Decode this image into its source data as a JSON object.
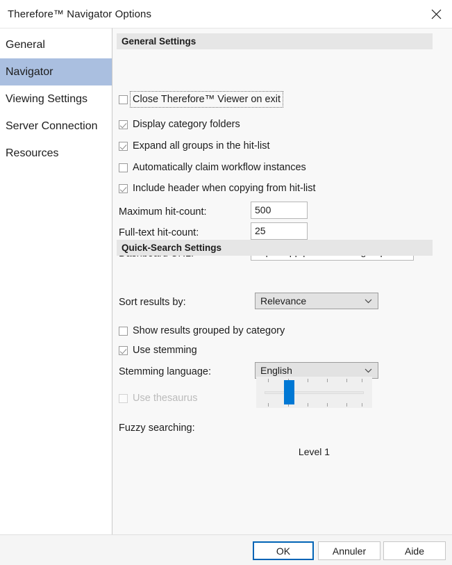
{
  "window": {
    "title": "Therefore™ Navigator Options",
    "close_icon": "close-icon"
  },
  "sidebar": {
    "items": [
      {
        "label": "General",
        "selected": false
      },
      {
        "label": "Navigator",
        "selected": true
      },
      {
        "label": "Viewing Settings",
        "selected": false
      },
      {
        "label": "Server Connection",
        "selected": false
      },
      {
        "label": "Resources",
        "selected": false
      }
    ],
    "selected_color": "#aabfe0"
  },
  "general_settings": {
    "header": "General Settings",
    "checkboxes": [
      {
        "label": "Close Therefore™ Viewer on exit",
        "checked": false,
        "enabled": true,
        "focused": true
      },
      {
        "label": "Display category folders",
        "checked": true,
        "enabled": true,
        "focused": false
      },
      {
        "label": "Expand all groups in the hit-list",
        "checked": true,
        "enabled": true,
        "focused": false
      },
      {
        "label": "Automatically claim workflow instances",
        "checked": false,
        "enabled": true,
        "focused": false
      },
      {
        "label": "Include header when copying from hit-list",
        "checked": true,
        "enabled": true,
        "focused": false
      }
    ],
    "fields": [
      {
        "label": "Maximum hit-count:",
        "value": "500"
      },
      {
        "label": "Full-text hit-count:",
        "value": "25"
      },
      {
        "label": "Dashboard URL:",
        "value": "https://app.powerbi.com/groups/me/d"
      }
    ]
  },
  "quick_search_settings": {
    "header": "Quick-Search Settings",
    "sort_results_label": "Sort results by:",
    "sort_results_value": "Relevance",
    "sort_results_options": [
      "Relevance"
    ],
    "show_grouped": {
      "label": "Show results grouped by category",
      "checked": false,
      "enabled": true
    },
    "use_stemming": {
      "label": "Use stemming",
      "checked": true,
      "enabled": true
    },
    "stemming_language_label": "Stemming language:",
    "stemming_language_value": "English",
    "stemming_language_options": [
      "English"
    ],
    "use_thesaurus": {
      "label": "Use thesaurus",
      "checked": false,
      "enabled": false
    },
    "fuzzy_label": "Fuzzy searching:",
    "fuzzy_level_caption": "Level 1",
    "fuzzy_value": 1,
    "fuzzy_min": 0,
    "fuzzy_max": 5,
    "fuzzy_accent": "#0078d4"
  },
  "footer": {
    "ok": "OK",
    "cancel": "Annuler",
    "help": "Aide"
  }
}
